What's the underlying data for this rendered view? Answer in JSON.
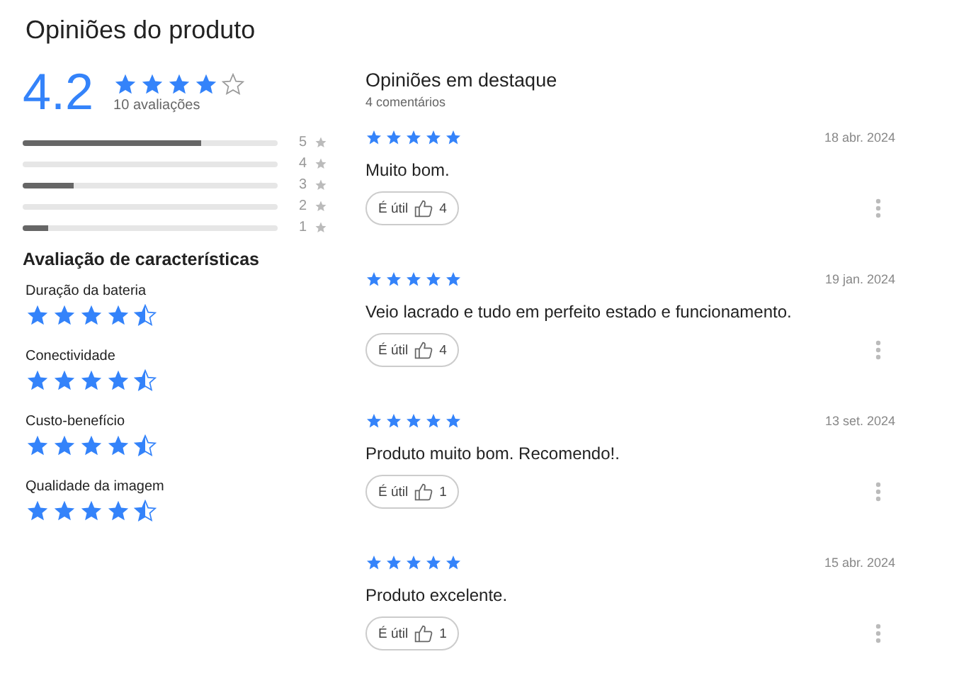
{
  "title": "Opiniões do produto",
  "summary": {
    "average": "4.2",
    "stars": 4,
    "count": "10 avaliações",
    "bars": [
      {
        "label": "5",
        "level": 0.7
      },
      {
        "label": "4",
        "level": 0
      },
      {
        "label": "3",
        "level": 0.2
      },
      {
        "label": "2",
        "level": 0
      },
      {
        "label": "1",
        "level": 0.1
      }
    ]
  },
  "characteristics": {
    "heading": "Avaliação de características",
    "items": [
      {
        "name": "Duração da bateria",
        "stars": 4.5
      },
      {
        "name": "Conectividade",
        "stars": 4.5
      },
      {
        "name": "Custo-benefício",
        "stars": 4.5
      },
      {
        "name": "Qualidade da imagem",
        "stars": 4.5
      }
    ]
  },
  "featured": {
    "heading": "Opiniões em destaque",
    "count": "4 comentários",
    "reviews": [
      {
        "stars": 5,
        "date": "18 abr. 2024",
        "text": "Muito bom.",
        "helpful_label": "É útil",
        "helpful_count": "4"
      },
      {
        "stars": 5,
        "date": "19 jan. 2024",
        "text": "Veio lacrado e tudo em perfeito estado e funcionamento.",
        "helpful_label": "É útil",
        "helpful_count": "4"
      },
      {
        "stars": 5,
        "date": "13 set. 2024",
        "text": "Produto muito bom. Recomendo!.",
        "helpful_label": "É útil",
        "helpful_count": "1"
      },
      {
        "stars": 5,
        "date": "15 abr. 2024",
        "text": "Produto excelente.",
        "helpful_label": "É útil",
        "helpful_count": "1"
      }
    ]
  }
}
